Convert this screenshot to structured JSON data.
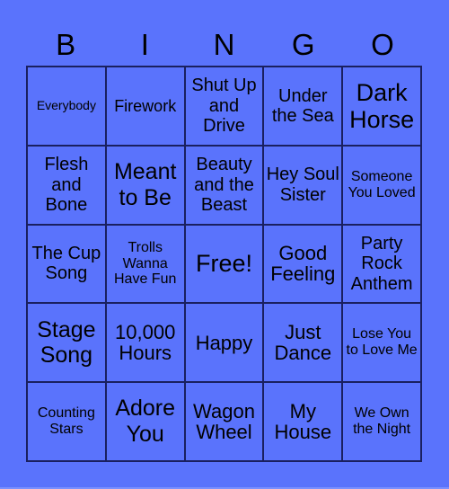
{
  "colors": {
    "background": "#5a73fc",
    "grid_line": "#1a2060",
    "text": "#000000"
  },
  "header": {
    "letters": [
      "B",
      "I",
      "N",
      "G",
      "O"
    ]
  },
  "cells": [
    [
      "Everybody",
      "Firework",
      "Shut Up and Drive",
      "Under the Sea",
      "Dark Horse"
    ],
    [
      "Flesh and Bone",
      "Meant to Be",
      "Beauty and the Beast",
      "Hey Soul Sister",
      "Someone You Loved"
    ],
    [
      "The Cup Song",
      "Trolls Wanna Have Fun",
      "Free!",
      "Good Feeling",
      "Party Rock Anthem"
    ],
    [
      "Stage Song",
      "10,000 Hours",
      "Happy",
      "Just Dance",
      "Lose You to Love Me"
    ],
    [
      "Counting Stars",
      "Adore You",
      "Wagon Wheel",
      "My House",
      "We Own the Night"
    ]
  ]
}
